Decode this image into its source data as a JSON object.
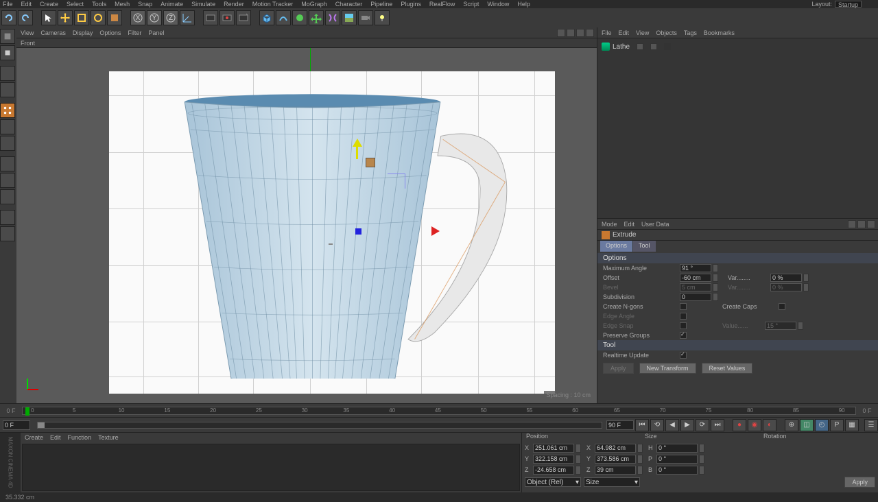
{
  "topmenu": [
    "File",
    "Edit",
    "Create",
    "Select",
    "Tools",
    "Mesh",
    "Snap",
    "Animate",
    "Simulate",
    "Render",
    "Motion Tracker",
    "MoGraph",
    "Character",
    "Pipeline",
    "Plugins",
    "RealFlow",
    "Script",
    "Window",
    "Help"
  ],
  "layout": {
    "label": "Layout:",
    "value": "Startup"
  },
  "viewmenu": [
    "View",
    "Cameras",
    "Display",
    "Options",
    "Filter",
    "Panel"
  ],
  "viewlabel": "Front",
  "spacing": "Spacing : 10 cm",
  "objmenu": [
    "File",
    "Edit",
    "View",
    "Objects",
    "Tags",
    "Bookmarks"
  ],
  "objects": [
    {
      "name": "Lathe"
    }
  ],
  "attrmenu": [
    "Mode",
    "Edit",
    "User Data"
  ],
  "attrhead": "Extrude",
  "tabs": [
    "Options",
    "Tool"
  ],
  "sections": {
    "opt": "Options",
    "tool": "Tool"
  },
  "attr": {
    "maxangle_lbl": "Maximum Angle",
    "maxangle": "91 °",
    "offset_lbl": "Offset",
    "offset": "-60 cm",
    "var1_lbl": "Var........",
    "var1": "0 %",
    "bevel_lbl": "Bevel",
    "bevel": "5 cm",
    "var2_lbl": "Var........",
    "var2": "0 %",
    "subdiv_lbl": "Subdivision",
    "subdiv": "0",
    "ngons_lbl": "Create N-gons",
    "caps_lbl": "Create Caps",
    "edgeang_lbl": "Edge Angle",
    "edgeang": "",
    "edgesnap_lbl": "Edge Snap",
    "value_lbl": "Value......",
    "value": "15 °",
    "preserve_lbl": "Preserve Groups",
    "realtime_lbl": "Realtime Update",
    "apply": "Apply",
    "newtrans": "New Transform",
    "reset": "Reset Values"
  },
  "timeline": {
    "start": "0 F",
    "end": "0 F",
    "marks": [
      0,
      5,
      10,
      15,
      20,
      25,
      30,
      35,
      40,
      45,
      50,
      55,
      60,
      65,
      70,
      75,
      80,
      85,
      90
    ]
  },
  "playbar": {
    "left": "0 F",
    "right": "90 F"
  },
  "matmenu": [
    "Create",
    "Edit",
    "Function",
    "Texture"
  ],
  "coordhead": [
    "Position",
    "Size",
    "Rotation"
  ],
  "coord": {
    "x": {
      "p": "251.061 cm",
      "s": "64.982 cm",
      "r": "0 °",
      "rl": "H"
    },
    "y": {
      "p": "322.158 cm",
      "s": "373.586 cm",
      "r": "0 °",
      "rl": "P"
    },
    "z": {
      "p": "-24.658 cm",
      "s": "39 cm",
      "r": "0 °",
      "rl": "B"
    }
  },
  "coordfoot": {
    "mode": "Object (Rel)",
    "size": "Size",
    "apply": "Apply"
  },
  "status": "35.332 cm",
  "logo": "MAXON CINEMA 4D"
}
